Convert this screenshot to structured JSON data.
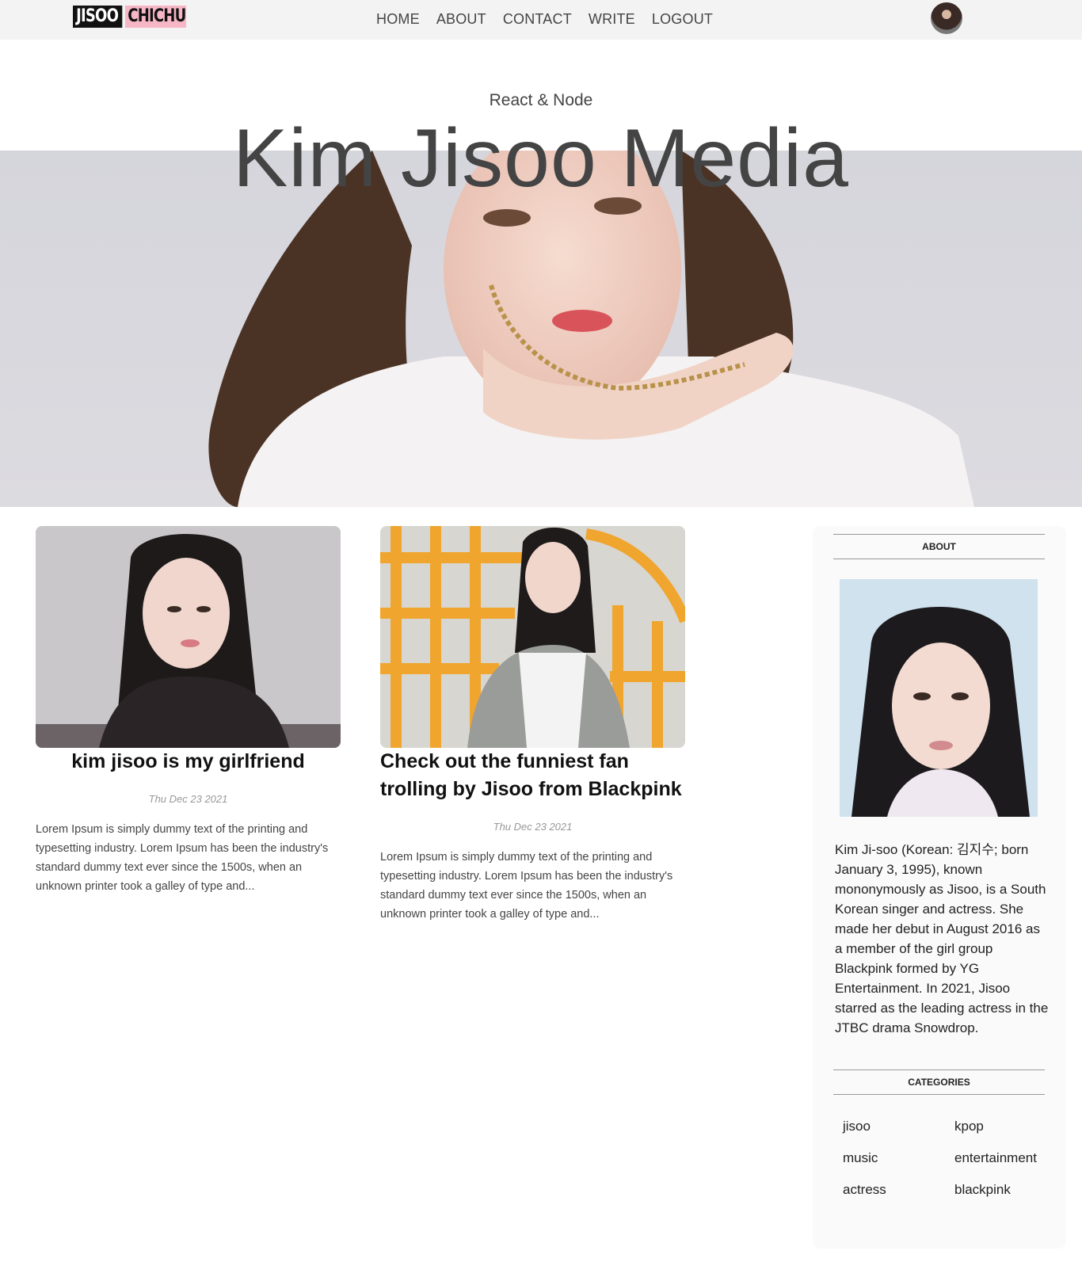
{
  "brand": {
    "logo_part1": "JISOO",
    "logo_part2": "CHICHU"
  },
  "nav": {
    "items": [
      "HOME",
      "ABOUT",
      "CONTACT",
      "WRITE",
      "LOGOUT"
    ]
  },
  "header": {
    "subtitle": "React & Node",
    "title": "Kim Jisoo Media"
  },
  "posts": [
    {
      "title": "kim jisoo is my girlfriend",
      "date": "Thu Dec 23 2021",
      "excerpt": "Lorem Ipsum is simply dummy text of the printing and typesetting industry. Lorem Ipsum has been the industry's standard dummy text ever since the 1500s, when an unknown printer took a galley of type and..."
    },
    {
      "title": "Check out the funniest fan trolling by Jisoo from Blackpink",
      "date": "Thu Dec 23 2021",
      "excerpt": "Lorem Ipsum is simply dummy text of the printing and typesetting industry. Lorem Ipsum has been the industry's standard dummy text ever since the 1500s, when an unknown printer took a galley of type and..."
    }
  ],
  "sidebar": {
    "about_heading": "ABOUT",
    "about_text": "Kim Ji-soo (Korean: 김지수; born January 3, 1995), known mononymously as Jisoo, is a South Korean singer and actress. She made her debut in August 2016 as a member of the girl group Blackpink formed by YG Entertainment. In 2021, Jisoo starred as the leading actress in the JTBC drama Snowdrop.",
    "categories_heading": "CATEGORIES",
    "categories": [
      "jisoo",
      "kpop",
      "music",
      "entertainment",
      "actress",
      "blackpink"
    ]
  },
  "colors": {
    "topbar": "#f3f3f3",
    "logo_pink": "#f7b6c6",
    "sidebar_bg": "#fafafa"
  }
}
